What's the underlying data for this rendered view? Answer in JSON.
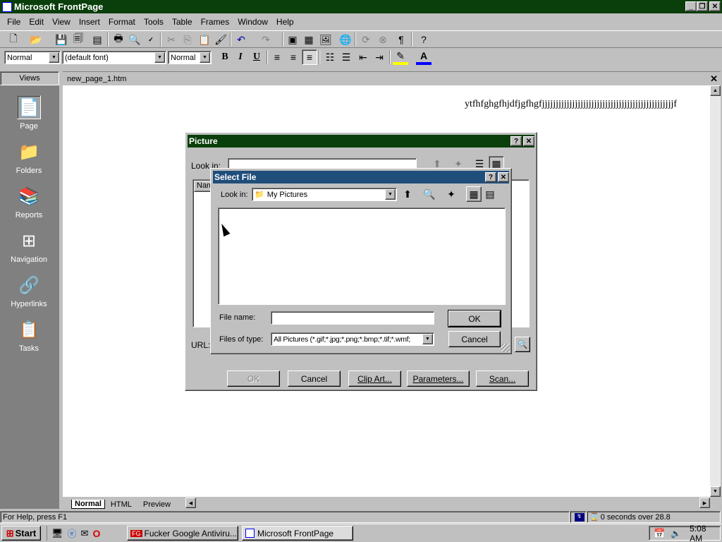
{
  "window": {
    "title": "Microsoft FrontPage"
  },
  "menu": [
    "File",
    "Edit",
    "View",
    "Insert",
    "Format",
    "Tools",
    "Table",
    "Frames",
    "Window",
    "Help"
  ],
  "format_bar": {
    "style": "Normal",
    "font": "(default font)",
    "size": "Normal"
  },
  "views": {
    "header": "Views",
    "items": [
      {
        "label": "Page",
        "icon": "page-icon"
      },
      {
        "label": "Folders",
        "icon": "folders-icon"
      },
      {
        "label": "Reports",
        "icon": "reports-icon"
      },
      {
        "label": "Navigation",
        "icon": "navigation-icon"
      },
      {
        "label": "Hyperlinks",
        "icon": "hyperlinks-icon"
      },
      {
        "label": "Tasks",
        "icon": "tasks-icon"
      }
    ]
  },
  "document": {
    "tab": "new_page_1.htm",
    "content": "ytfhfghgfhjdfjgfhgfjjjjjjjjjjjjjjjjjjjjjjjjjjjjjjjjjjjjjjjjjjjjjjjjf",
    "bottom_tabs": [
      "Normal",
      "HTML",
      "Preview"
    ]
  },
  "picture_dialog": {
    "title": "Picture",
    "look_in_label": "Look in:",
    "list_header": "Nam",
    "url_label": "URL:",
    "buttons": {
      "ok": "OK",
      "cancel": "Cancel",
      "clip_art": "Clip Art...",
      "parameters": "Parameters...",
      "scan": "Scan..."
    }
  },
  "select_file_dialog": {
    "title": "Select File",
    "look_in_label": "Look in:",
    "look_in_value": "My Pictures",
    "file_name_label": "File name:",
    "file_name_value": "",
    "files_of_type_label": "Files of type:",
    "files_of_type_value": "All Pictures (*.gif;*.jpg;*.png;*.bmp;*.tif;*.wmf;",
    "ok": "OK",
    "cancel": "Cancel"
  },
  "status": {
    "help": "For Help, press F1",
    "timer": "0 seconds over 28.8"
  },
  "taskbar": {
    "start": "Start",
    "tasks": [
      "Fucker Google Antiviru...",
      "Microsoft FrontPage"
    ],
    "clock": "5:08 AM"
  },
  "colors": {
    "title_active": "#0a3e0a",
    "dialog_title": "#0a3e0a",
    "select_title": "#1f4e7a",
    "views_bg": "#808080"
  }
}
